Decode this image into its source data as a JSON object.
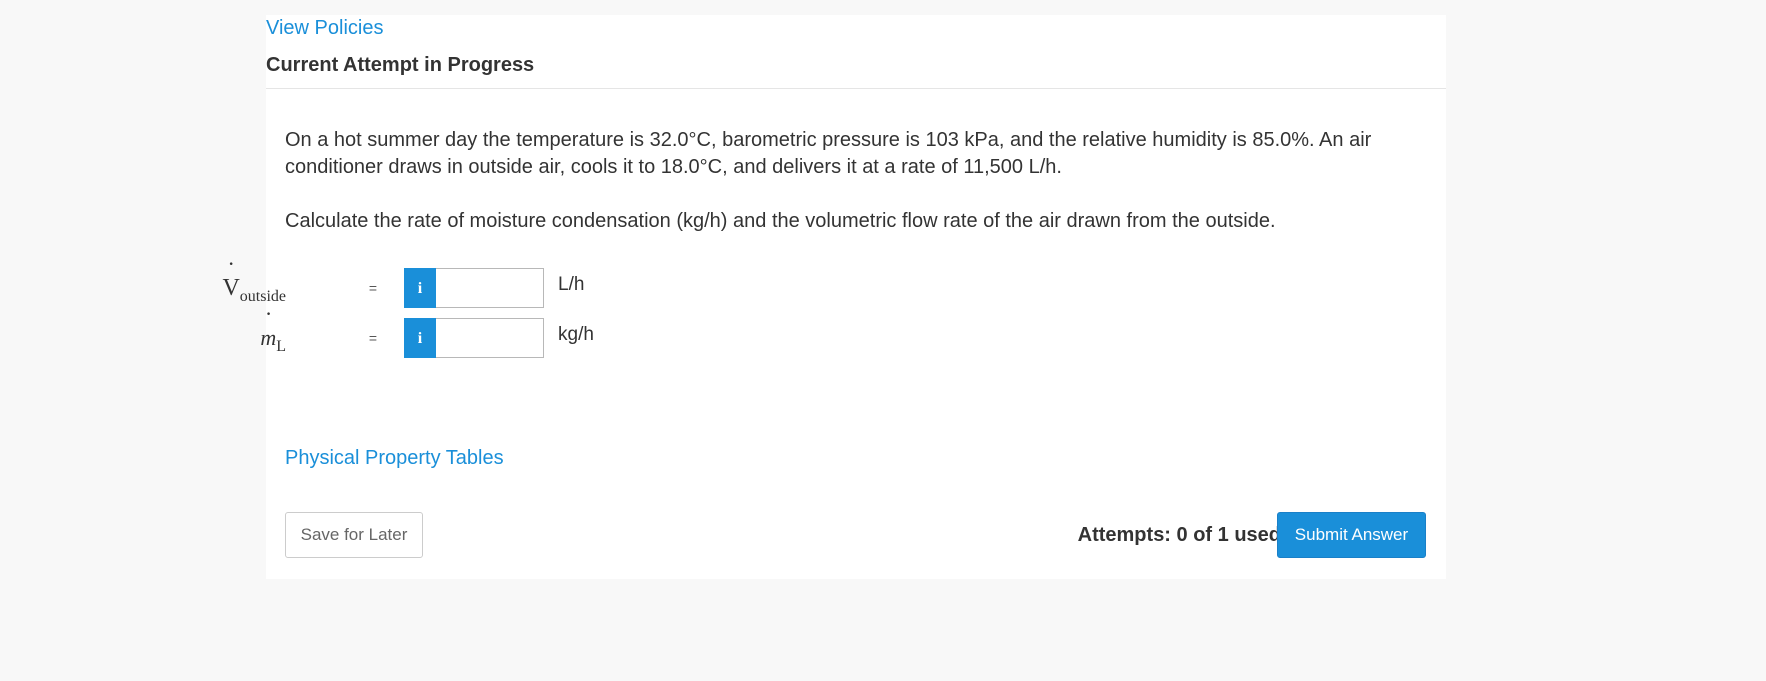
{
  "header": {
    "policies_link": "View Policies",
    "attempt_title": "Current Attempt in Progress"
  },
  "question": {
    "paragraph1": "On a hot summer day the temperature is 32.0°C, barometric pressure is 103 kPa, and the relative humidity is 85.0%. An air conditioner draws in outside air, cools it to 18.0°C, and delivers it at a rate of 11,500 L/h.",
    "paragraph2": "Calculate the rate of moisture condensation (kg/h) and the volumetric flow rate of the air drawn from the outside."
  },
  "answers": [
    {
      "symbol": "V",
      "dot": "·",
      "subscript": "outside",
      "equals": "=",
      "info_icon": "i",
      "value": "",
      "unit": "L/h"
    },
    {
      "symbol": "m",
      "dot": "·",
      "subscript": "L",
      "equals": "=",
      "info_icon": "i",
      "value": "",
      "unit": "kg/h"
    }
  ],
  "footer": {
    "tables_link": "Physical Property Tables",
    "save_label": "Save for Later",
    "attempts_text": "Attempts: 0 of 1 used",
    "submit_label": "Submit Answer"
  },
  "colors": {
    "accent": "#1a8fd9",
    "background": "#f8f8f8",
    "text": "#333333"
  }
}
